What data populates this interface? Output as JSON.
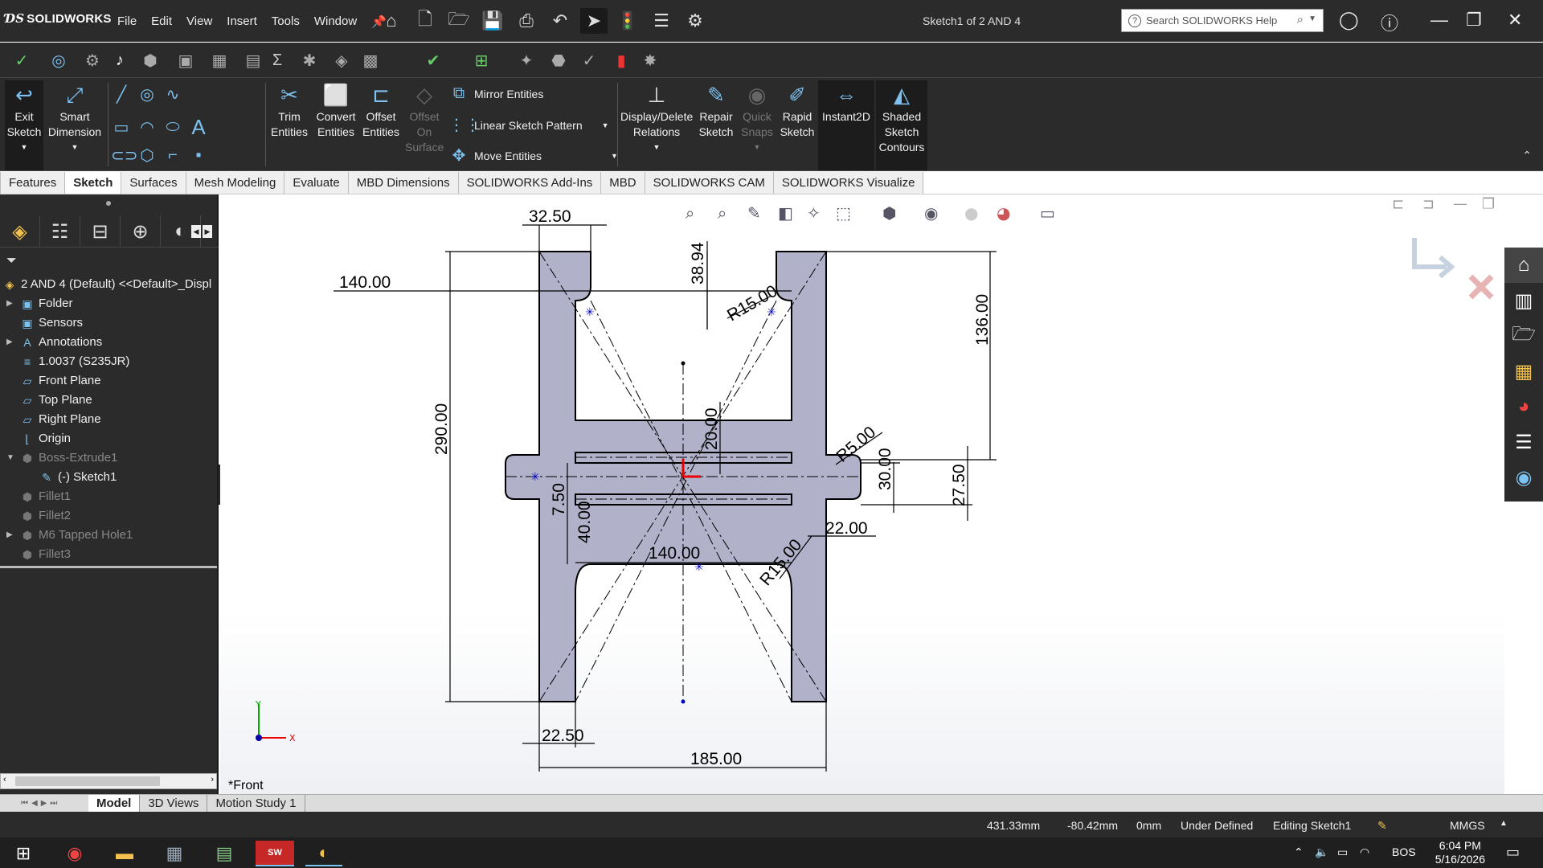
{
  "app": {
    "brand": "SOLIDWORKS",
    "doc_title": "Sketch1 of 2 AND 4"
  },
  "menu": [
    "File",
    "Edit",
    "View",
    "Insert",
    "Tools",
    "Window"
  ],
  "search": {
    "placeholder": "Search SOLIDWORKS Help"
  },
  "ribbon": {
    "exit_sketch": [
      "Exit",
      "Sketch"
    ],
    "smart_dimension": [
      "Smart",
      "Dimension"
    ],
    "trim": [
      "Trim",
      "Entities"
    ],
    "convert": [
      "Convert",
      "Entities"
    ],
    "offset": [
      "Offset",
      "Entities"
    ],
    "offset_surface": [
      "Offset",
      "On",
      "Surface"
    ],
    "mirror": "Mirror Entities",
    "linear_pattern": "Linear Sketch Pattern",
    "move": "Move Entities",
    "display_delete": [
      "Display/Delete",
      "Relations"
    ],
    "repair": [
      "Repair",
      "Sketch"
    ],
    "quick_snaps": [
      "Quick",
      "Snaps"
    ],
    "rapid_sketch": [
      "Rapid",
      "Sketch"
    ],
    "instant2d": "Instant2D",
    "shaded": [
      "Shaded",
      "Sketch",
      "Contours"
    ]
  },
  "command_tabs": [
    "Features",
    "Sketch",
    "Surfaces",
    "Mesh Modeling",
    "Evaluate",
    "MBD Dimensions",
    "SOLIDWORKS Add-Ins",
    "MBD",
    "SOLIDWORKS CAM",
    "SOLIDWORKS Visualize"
  ],
  "active_tab": "Sketch",
  "tree": {
    "root": "2 AND 4 (Default) <<Default>_Displ",
    "items": [
      {
        "label": "Folder",
        "expand": true,
        "dim": false
      },
      {
        "label": "Sensors",
        "expand": false,
        "dim": false
      },
      {
        "label": "Annotations",
        "expand": true,
        "dim": false
      },
      {
        "label": "1.0037 (S235JR)",
        "expand": false,
        "dim": false
      },
      {
        "label": "Front Plane",
        "expand": false,
        "dim": false
      },
      {
        "label": "Top Plane",
        "expand": false,
        "dim": false
      },
      {
        "label": "Right Plane",
        "expand": false,
        "dim": false
      },
      {
        "label": "Origin",
        "expand": false,
        "dim": false
      },
      {
        "label": "Boss-Extrude1",
        "expand": true,
        "dim": true
      },
      {
        "label": "(-) Sketch1",
        "expand": false,
        "dim": false,
        "indent": true
      },
      {
        "label": "Fillet1",
        "expand": false,
        "dim": true
      },
      {
        "label": "Fillet2",
        "expand": false,
        "dim": true
      },
      {
        "label": "M6 Tapped Hole1",
        "expand": true,
        "dim": true
      },
      {
        "label": "Fillet3",
        "expand": false,
        "dim": true
      }
    ]
  },
  "dimensions": {
    "d1": "32.50",
    "d2": "140.00",
    "d3": "38.94",
    "d4": "R15.00",
    "d5": "136.00",
    "d6": "290.00",
    "d7": "20.00",
    "d8": "R5.00",
    "d9": "30.00",
    "d10": "27.50",
    "d11": "7.50",
    "d12": "40.00",
    "d13": "22.00",
    "d14": "140.00",
    "d15": "R15.00",
    "d16": "22.50",
    "d17": "185.00"
  },
  "view_label": "*Front",
  "bottom_tabs": [
    "Model",
    "3D Views",
    "Motion Study 1"
  ],
  "status": {
    "x": "431.33mm",
    "y": "-80.42mm",
    "z": "0mm",
    "state": "Under Defined",
    "editing": "Editing Sketch1",
    "units": "MMGS"
  },
  "taskbar": {
    "lang": "BOS",
    "time": "6:04 PM",
    "date": "5/16/2026"
  },
  "colors": {
    "chrome": "#2b2b2b",
    "sketch_fill": "#b1b1c9",
    "accent_blue": "#7cc1ef"
  }
}
